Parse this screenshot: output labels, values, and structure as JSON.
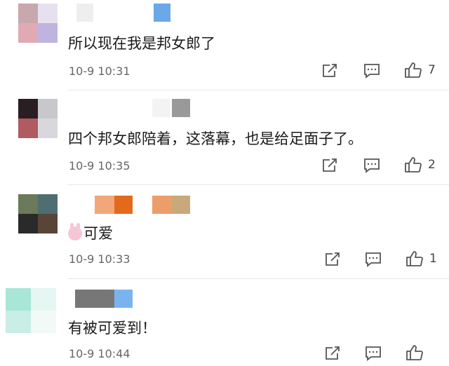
{
  "comments": [
    {
      "text": "所以现在我是邦女郎了",
      "time": "10-9 10:31",
      "likes": "7",
      "avatar_colors": [
        "#c9a7ae",
        "#e7e0ee",
        "#e0aab5",
        "#bfb3e0"
      ],
      "name_blocks": [
        "#eeeeee",
        "#6aa8e8"
      ]
    },
    {
      "text": "四个邦女郎陪着，这落幕，也是给足面子了。",
      "time": "10-9 10:35",
      "likes": "2",
      "avatar_colors": [
        "#2a1e22",
        "#c8c8cc",
        "#b05a62",
        "#d8d8dc"
      ],
      "name_blocks": [
        "#f3f3f3",
        "#999999"
      ]
    },
    {
      "text": "可爱",
      "emoji": "bunny-face",
      "time": "10-9 10:33",
      "likes": "1",
      "avatar_colors": [
        "#6b7a5a",
        "#4e6e72",
        "#2a2a2a",
        "#5a4438"
      ],
      "name_blocks": [
        "#f2a77a",
        "#e36a1c",
        "#ec9e6a",
        "#c9a87a"
      ]
    },
    {
      "text": "有被可爱到！",
      "time": "10-9 10:44",
      "likes": "",
      "avatar_colors": [
        "#a8e6d8",
        "#e6f6f2",
        "#c8eee6",
        "#f2faf8"
      ],
      "name_blocks": [
        "#777777",
        "#7ab4f0"
      ]
    }
  ],
  "icons": {
    "share": "share-icon",
    "reply": "comment-icon",
    "like": "thumbs-up-icon"
  },
  "colors": {
    "text": "#1a1a1a",
    "meta": "#666666",
    "icon": "#555555"
  }
}
